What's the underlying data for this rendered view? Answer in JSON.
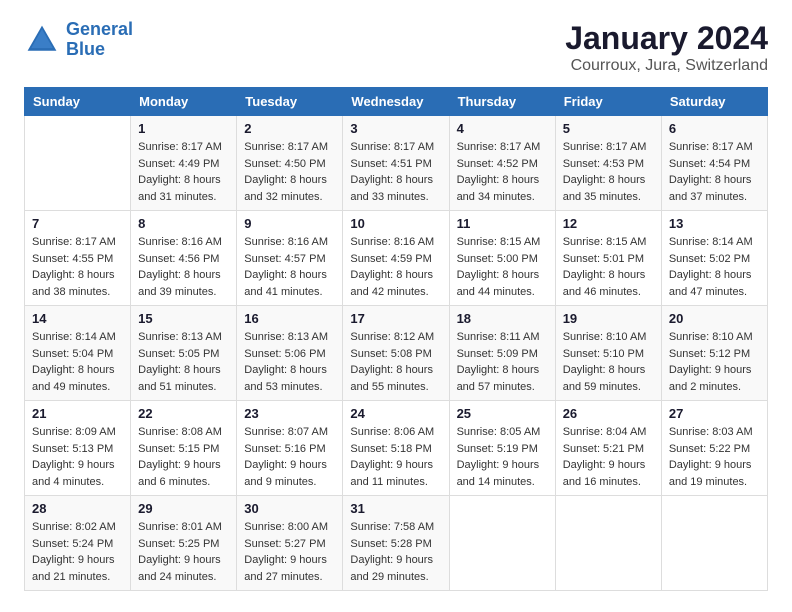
{
  "logo": {
    "line1": "General",
    "line2": "Blue"
  },
  "title": "January 2024",
  "subtitle": "Courroux, Jura, Switzerland",
  "days_header": [
    "Sunday",
    "Monday",
    "Tuesday",
    "Wednesday",
    "Thursday",
    "Friday",
    "Saturday"
  ],
  "weeks": [
    [
      {
        "day": "",
        "info": ""
      },
      {
        "day": "1",
        "info": "Sunrise: 8:17 AM\nSunset: 4:49 PM\nDaylight: 8 hours\nand 31 minutes."
      },
      {
        "day": "2",
        "info": "Sunrise: 8:17 AM\nSunset: 4:50 PM\nDaylight: 8 hours\nand 32 minutes."
      },
      {
        "day": "3",
        "info": "Sunrise: 8:17 AM\nSunset: 4:51 PM\nDaylight: 8 hours\nand 33 minutes."
      },
      {
        "day": "4",
        "info": "Sunrise: 8:17 AM\nSunset: 4:52 PM\nDaylight: 8 hours\nand 34 minutes."
      },
      {
        "day": "5",
        "info": "Sunrise: 8:17 AM\nSunset: 4:53 PM\nDaylight: 8 hours\nand 35 minutes."
      },
      {
        "day": "6",
        "info": "Sunrise: 8:17 AM\nSunset: 4:54 PM\nDaylight: 8 hours\nand 37 minutes."
      }
    ],
    [
      {
        "day": "7",
        "info": "Sunrise: 8:17 AM\nSunset: 4:55 PM\nDaylight: 8 hours\nand 38 minutes."
      },
      {
        "day": "8",
        "info": "Sunrise: 8:16 AM\nSunset: 4:56 PM\nDaylight: 8 hours\nand 39 minutes."
      },
      {
        "day": "9",
        "info": "Sunrise: 8:16 AM\nSunset: 4:57 PM\nDaylight: 8 hours\nand 41 minutes."
      },
      {
        "day": "10",
        "info": "Sunrise: 8:16 AM\nSunset: 4:59 PM\nDaylight: 8 hours\nand 42 minutes."
      },
      {
        "day": "11",
        "info": "Sunrise: 8:15 AM\nSunset: 5:00 PM\nDaylight: 8 hours\nand 44 minutes."
      },
      {
        "day": "12",
        "info": "Sunrise: 8:15 AM\nSunset: 5:01 PM\nDaylight: 8 hours\nand 46 minutes."
      },
      {
        "day": "13",
        "info": "Sunrise: 8:14 AM\nSunset: 5:02 PM\nDaylight: 8 hours\nand 47 minutes."
      }
    ],
    [
      {
        "day": "14",
        "info": "Sunrise: 8:14 AM\nSunset: 5:04 PM\nDaylight: 8 hours\nand 49 minutes."
      },
      {
        "day": "15",
        "info": "Sunrise: 8:13 AM\nSunset: 5:05 PM\nDaylight: 8 hours\nand 51 minutes."
      },
      {
        "day": "16",
        "info": "Sunrise: 8:13 AM\nSunset: 5:06 PM\nDaylight: 8 hours\nand 53 minutes."
      },
      {
        "day": "17",
        "info": "Sunrise: 8:12 AM\nSunset: 5:08 PM\nDaylight: 8 hours\nand 55 minutes."
      },
      {
        "day": "18",
        "info": "Sunrise: 8:11 AM\nSunset: 5:09 PM\nDaylight: 8 hours\nand 57 minutes."
      },
      {
        "day": "19",
        "info": "Sunrise: 8:10 AM\nSunset: 5:10 PM\nDaylight: 8 hours\nand 59 minutes."
      },
      {
        "day": "20",
        "info": "Sunrise: 8:10 AM\nSunset: 5:12 PM\nDaylight: 9 hours\nand 2 minutes."
      }
    ],
    [
      {
        "day": "21",
        "info": "Sunrise: 8:09 AM\nSunset: 5:13 PM\nDaylight: 9 hours\nand 4 minutes."
      },
      {
        "day": "22",
        "info": "Sunrise: 8:08 AM\nSunset: 5:15 PM\nDaylight: 9 hours\nand 6 minutes."
      },
      {
        "day": "23",
        "info": "Sunrise: 8:07 AM\nSunset: 5:16 PM\nDaylight: 9 hours\nand 9 minutes."
      },
      {
        "day": "24",
        "info": "Sunrise: 8:06 AM\nSunset: 5:18 PM\nDaylight: 9 hours\nand 11 minutes."
      },
      {
        "day": "25",
        "info": "Sunrise: 8:05 AM\nSunset: 5:19 PM\nDaylight: 9 hours\nand 14 minutes."
      },
      {
        "day": "26",
        "info": "Sunrise: 8:04 AM\nSunset: 5:21 PM\nDaylight: 9 hours\nand 16 minutes."
      },
      {
        "day": "27",
        "info": "Sunrise: 8:03 AM\nSunset: 5:22 PM\nDaylight: 9 hours\nand 19 minutes."
      }
    ],
    [
      {
        "day": "28",
        "info": "Sunrise: 8:02 AM\nSunset: 5:24 PM\nDaylight: 9 hours\nand 21 minutes."
      },
      {
        "day": "29",
        "info": "Sunrise: 8:01 AM\nSunset: 5:25 PM\nDaylight: 9 hours\nand 24 minutes."
      },
      {
        "day": "30",
        "info": "Sunrise: 8:00 AM\nSunset: 5:27 PM\nDaylight: 9 hours\nand 27 minutes."
      },
      {
        "day": "31",
        "info": "Sunrise: 7:58 AM\nSunset: 5:28 PM\nDaylight: 9 hours\nand 29 minutes."
      },
      {
        "day": "",
        "info": ""
      },
      {
        "day": "",
        "info": ""
      },
      {
        "day": "",
        "info": ""
      }
    ]
  ]
}
